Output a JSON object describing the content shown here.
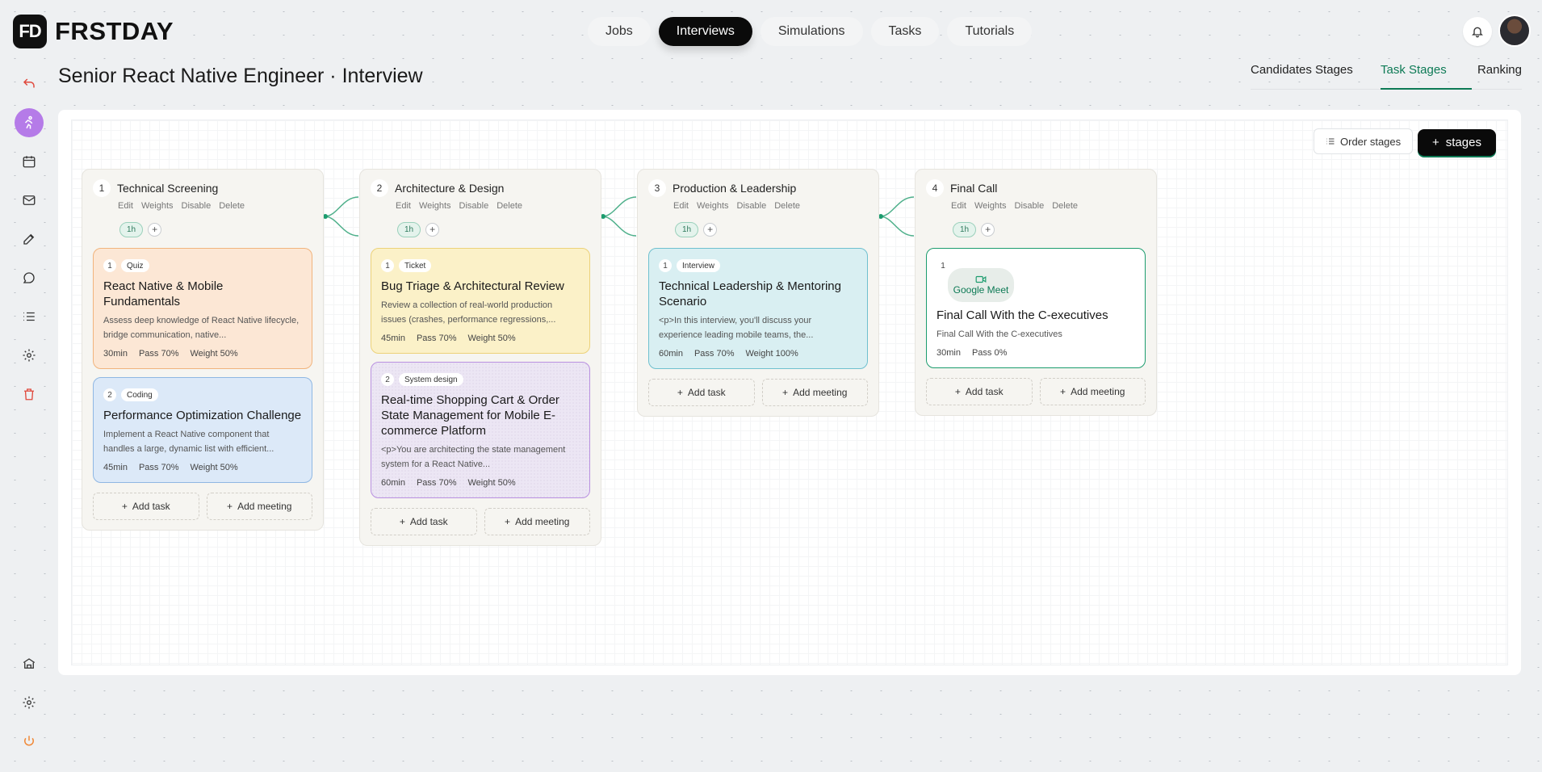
{
  "brand": {
    "mark": "FD",
    "name": "FRSTDAY"
  },
  "topnav": [
    "Jobs",
    "Interviews",
    "Simulations",
    "Tasks",
    "Tutorials"
  ],
  "topnav_active": "Interviews",
  "page_title": "Senior React Native Engineer · Interview",
  "subnav": [
    "Candidates Stages",
    "Task Stages",
    "Ranking"
  ],
  "subnav_active": "Task Stages",
  "board_actions": {
    "order": "Order stages",
    "add": "stages"
  },
  "stage_actions": [
    "Edit",
    "Weights",
    "Disable",
    "Delete"
  ],
  "stages": [
    {
      "num": "1",
      "title": "Technical Screening",
      "chip": "1h",
      "tasks": [
        {
          "num": "1",
          "type": "Quiz",
          "title": "React Native & Mobile Fundamentals",
          "desc": "Assess deep knowledge of React Native lifecycle, bridge communication, native...",
          "duration": "30min",
          "pass": "Pass 70%",
          "weight": "Weight 50%"
        },
        {
          "num": "2",
          "type": "Coding",
          "title": "Performance Optimization Challenge",
          "desc": "Implement a React Native component that handles a large, dynamic list with efficient...",
          "duration": "45min",
          "pass": "Pass 70%",
          "weight": "Weight 50%"
        }
      ],
      "add_task": "Add task",
      "add_meeting": "Add meeting"
    },
    {
      "num": "2",
      "title": "Architecture & Design",
      "chip": "1h",
      "tasks": [
        {
          "num": "1",
          "type": "Ticket",
          "title": "Bug Triage & Architectural Review",
          "desc": "Review a collection of real-world production issues (crashes, performance regressions,...",
          "duration": "45min",
          "pass": "Pass 70%",
          "weight": "Weight 50%"
        },
        {
          "num": "2",
          "type": "System design",
          "title": "Real-time Shopping Cart & Order State Management for Mobile E-commerce Platform",
          "desc": "<p>You are architecting the state management system for a React Native...",
          "duration": "60min",
          "pass": "Pass 70%",
          "weight": "Weight 50%"
        }
      ],
      "add_task": "Add task",
      "add_meeting": "Add meeting"
    },
    {
      "num": "3",
      "title": "Production & Leadership",
      "chip": "1h",
      "tasks": [
        {
          "num": "1",
          "type": "Interview",
          "title": "Technical Leadership & Mentoring Scenario",
          "desc": "<p>In this interview, you'll discuss your experience leading mobile teams, the...",
          "duration": "60min",
          "pass": "Pass 70%",
          "weight": "Weight 100%"
        }
      ],
      "add_task": "Add task",
      "add_meeting": "Add meeting"
    },
    {
      "num": "4",
      "title": "Final Call",
      "chip": "1h",
      "tasks": [
        {
          "num": "1",
          "type": "Google Meet",
          "title": "Final Call With the C-executives",
          "desc": "Final Call With the C-executives",
          "duration": "30min",
          "pass": "Pass 0%"
        }
      ],
      "add_task": "Add task",
      "add_meeting": "Add meeting"
    }
  ],
  "colors": {
    "accent": "#0d7a55",
    "active_sidebar": "#b57be8",
    "danger": "#e0483c"
  }
}
